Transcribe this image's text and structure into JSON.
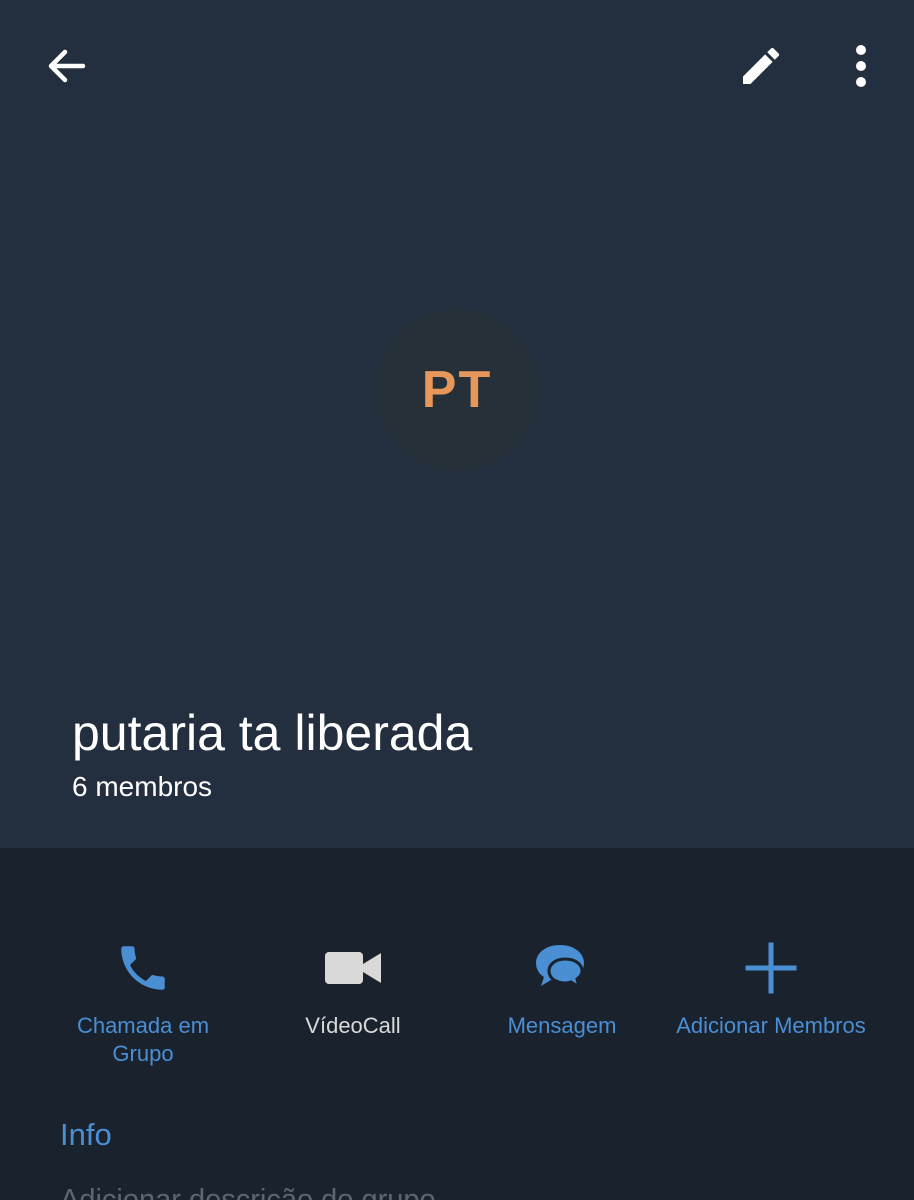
{
  "colors": {
    "header_bg": "#232f3e",
    "body_bg": "#1a222d",
    "accent_blue": "#4a8ed4",
    "avatar_bg": "#263038",
    "avatar_text": "#e8975a",
    "muted_label": "#d9d9d9",
    "placeholder_text": "#5c6672"
  },
  "toolbar": {
    "back_icon": "arrow-left-icon",
    "edit_icon": "pencil-icon",
    "more_icon": "more-vertical-icon"
  },
  "group": {
    "initials": "PT",
    "name": "putaria ta liberada",
    "members": "6 membros"
  },
  "actions": [
    {
      "label": "Chamada em\nGrupo",
      "icon": "phone-icon"
    },
    {
      "label": "VídeoCall",
      "icon": "video-camera-icon"
    },
    {
      "label": "Mensagem",
      "icon": "chat-bubbles-icon"
    },
    {
      "label": "Adicionar Membros",
      "icon": "plus-icon"
    }
  ],
  "info": {
    "title": "Info",
    "description_placeholder": "Adicionar descrição do grupo"
  }
}
